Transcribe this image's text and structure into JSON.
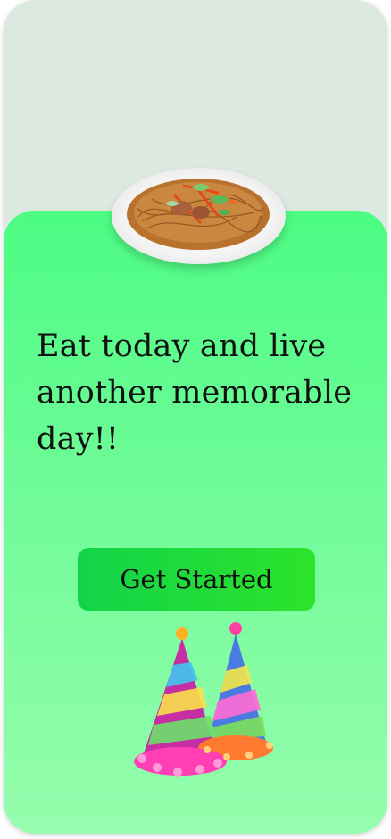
{
  "screen": {
    "headline": "Eat today and live another memorable day!!",
    "cta_label": "Get Started"
  },
  "images": {
    "dish": "noodle-plate-image",
    "decoration": "party-hats-image"
  },
  "colors": {
    "background_top": "#dbe9e0",
    "card_gradient_start": "#4cfc83",
    "card_gradient_end": "#96fdae",
    "button_start": "#12d44a",
    "button_end": "#2de32a",
    "text": "#111111"
  }
}
